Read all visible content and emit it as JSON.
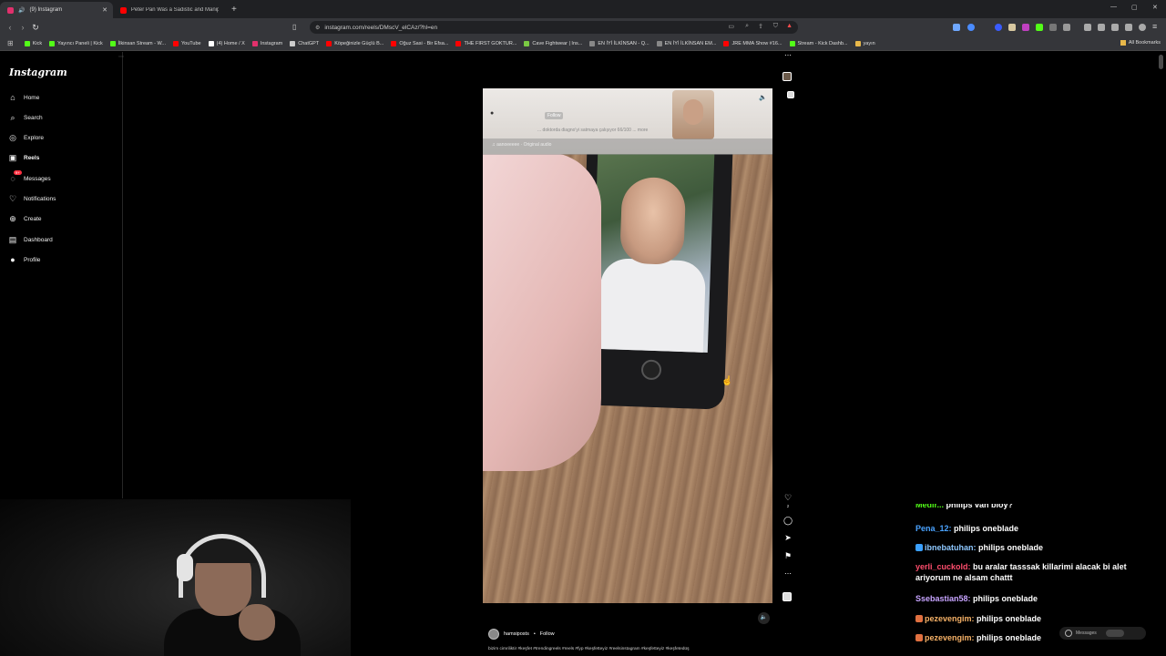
{
  "browser": {
    "tabs": [
      {
        "label": "(9) Instagram",
        "active": true
      },
      {
        "label": "Peter Pan Was a Sadistic and Manip...",
        "active": false
      }
    ],
    "url": "instagram.com/reels/DMscV_elCAz/?hl=en",
    "bookmarks": [
      {
        "label": "Kick",
        "color": "#53fc18"
      },
      {
        "label": "Yayıncı Paneli | Kick",
        "color": "#53fc18"
      },
      {
        "label": "İlkinsan Stream - W...",
        "color": "#53fc18"
      },
      {
        "label": "YouTube",
        "color": "#ff0000"
      },
      {
        "label": "(4) Home / X",
        "color": "#ffffff"
      },
      {
        "label": "Instagram",
        "color": "#e1306c"
      },
      {
        "label": "ChatGPT",
        "color": "#cccccc"
      },
      {
        "label": "Köpeğinizle Güçlü B...",
        "color": "#ff0000"
      },
      {
        "label": "Oğuz Sasi - Bir Efsa...",
        "color": "#ff0000"
      },
      {
        "label": "THE FIRST GOKTUR...",
        "color": "#ff0000"
      },
      {
        "label": "Cave Fightwear | Ins...",
        "color": "#7ac943"
      },
      {
        "label": "EN İYİ İLKİNSAN - Q...",
        "color": "#888888"
      },
      {
        "label": "EN İYİ İLKİNSAN EM...",
        "color": "#888888"
      },
      {
        "label": "JRE MMA Show #16...",
        "color": "#ff0000"
      },
      {
        "label": "Stream - Kick Dashb...",
        "color": "#53fc18"
      },
      {
        "label": "yayın",
        "color": "#e8b84a"
      }
    ],
    "all_bookmarks": "All Bookmarks"
  },
  "sidebar": {
    "logo": "Instagram",
    "items": [
      {
        "label": "Home",
        "icon": "home-icon"
      },
      {
        "label": "Search",
        "icon": "search-icon"
      },
      {
        "label": "Explore",
        "icon": "compass-icon"
      },
      {
        "label": "Reels",
        "icon": "reels-icon"
      },
      {
        "label": "Messages",
        "icon": "messenger-icon",
        "badge": "9+"
      },
      {
        "label": "Notifications",
        "icon": "heart-icon"
      },
      {
        "label": "Create",
        "icon": "plus-icon"
      },
      {
        "label": "Dashboard",
        "icon": "dashboard-icon"
      },
      {
        "label": "Profile",
        "icon": "avatar-icon"
      }
    ]
  },
  "reel": {
    "overlay_follow": "Follow",
    "overlay_caption": "... doktorda diagno'yi satmaya çalışıyor 66/100 ... more",
    "overlay_audio": "♫ aanoeeeee · Original audio",
    "like_count": "2",
    "author": "hamsiposts",
    "follow": "Follow",
    "caption": "bizim cimriliktir #keşfet #trendingreels #reels #fyp #keşfetteyiz #reelsinstagram #keşfetteyiz #keşfetedüş"
  },
  "chat": {
    "messages": [
      {
        "user": "Medir...",
        "text": "philips van bloy?",
        "color": "#53fc18",
        "partial": true
      },
      {
        "user": "Pena_12:",
        "text": "philips oneblade",
        "color": "#4aa3ff"
      },
      {
        "user": "ibnebatuhan:",
        "text": "philips oneblade",
        "color": "#8ec8ff",
        "emo": "#3aa0ff"
      },
      {
        "user": "yerli_cuckold:",
        "text": "bu aralar tasssak killarimi alacak bi alet ariyorum ne alsam chattt",
        "color": "#ff4d6d"
      },
      {
        "user": "Ssebastian58:",
        "text": "philips oneblade",
        "color": "#c7a4ff"
      },
      {
        "user": "pezevengim:",
        "text": "philips oneblade",
        "color": "#f7b267",
        "emo": "#e07040"
      },
      {
        "user": "pezevengim:",
        "text": "philips oneblade",
        "color": "#f7b267",
        "emo": "#e07040"
      }
    ]
  },
  "messages_pill": "Messages"
}
